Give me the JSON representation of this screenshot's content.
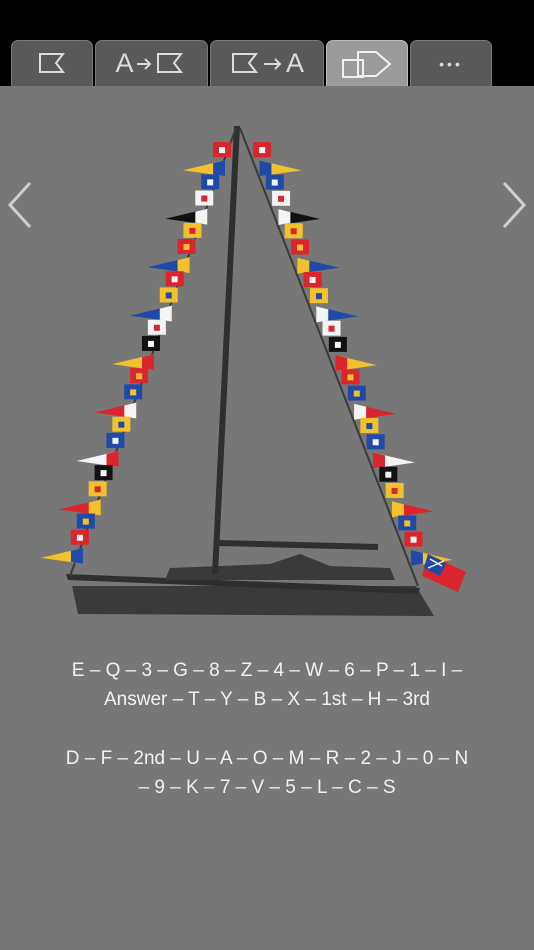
{
  "tabs": [
    {
      "id": "flag",
      "icon": "flag-icon",
      "active": false
    },
    {
      "id": "letter-to-flag",
      "label": "A",
      "icon": "arrow-right-flag-icon",
      "active": false
    },
    {
      "id": "flag-to-letter",
      "label": "A",
      "icon": "flag-arrow-right-icon",
      "active": false
    },
    {
      "id": "shapes",
      "icon": "shapes-icon",
      "active": true
    },
    {
      "id": "more",
      "label": "•••",
      "active": false
    }
  ],
  "nav": {
    "prev_icon": "chevron-left-icon",
    "next_icon": "chevron-right-icon"
  },
  "sequence": {
    "line1": "E – Q – 3 – G – 8 – Z – 4 – W – 6 – P – 1 – I –",
    "line2": "Answer – T – Y – B – X – 1st – H – 3rd",
    "line3": "D – F – 2nd – U – A – O – M – R – 2 – J – 0 – N",
    "line4": "– 9 – K – 7 – V – 5 – L – C – S"
  },
  "colors": {
    "background": "#777777",
    "topbar": "#000000",
    "tab": "#595959",
    "tab_active": "#9a9a9a",
    "hull": "#3a3a3a",
    "flag_red": "#d9252b",
    "flag_yellow": "#f2c12e",
    "flag_blue": "#1f4aa8",
    "flag_white": "#f4f4f4",
    "flag_black": "#111111"
  }
}
